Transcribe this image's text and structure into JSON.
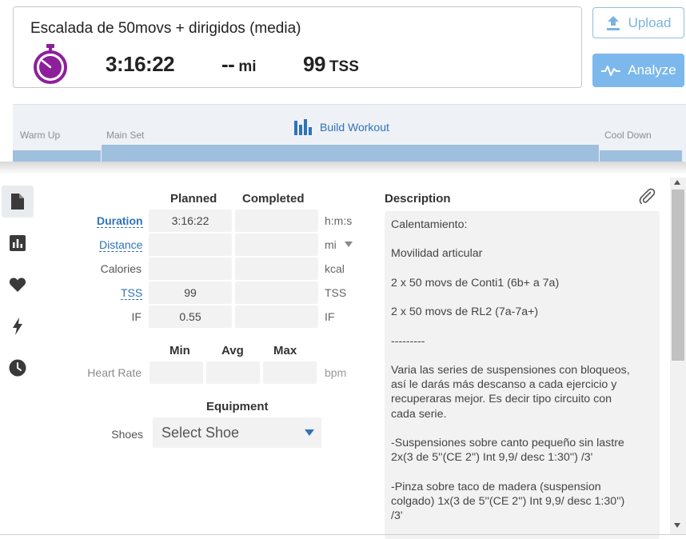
{
  "header": {
    "title": "Escalada de 50movs + dirigidos (media)",
    "duration": "3:16:22",
    "distance_value": "--",
    "distance_unit": "mi",
    "tss_value": "99",
    "tss_unit": "TSS",
    "accent_color": "#8e1f9a"
  },
  "actions": {
    "upload_label": "Upload",
    "analyze_label": "Analyze"
  },
  "builder": {
    "warm_up": "Warm Up",
    "main_set": "Main Set",
    "cool_down": "Cool Down",
    "build_link": "Build Workout"
  },
  "rail": [
    "document-icon",
    "chart-icon",
    "heart-icon",
    "bolt-icon",
    "clock-icon"
  ],
  "form": {
    "planned_header": "Planned",
    "completed_header": "Completed",
    "rows": [
      {
        "label": "Duration",
        "planned": "3:16:22",
        "completed": "",
        "unit": "h:m:s"
      },
      {
        "label": "Distance",
        "planned": "",
        "completed": "",
        "unit": "mi"
      },
      {
        "label": "Calories",
        "planned": "",
        "completed": "",
        "unit": "kcal"
      },
      {
        "label": "TSS",
        "planned": "99",
        "completed": "",
        "unit": "TSS"
      },
      {
        "label": "IF",
        "planned": "0.55",
        "completed": "",
        "unit": "IF"
      }
    ],
    "min_header": "Min",
    "avg_header": "Avg",
    "max_header": "Max",
    "heart_rate_label": "Heart Rate",
    "heart_rate_unit": "bpm",
    "equipment_header": "Equipment",
    "shoes_label": "Shoes",
    "shoes_value": "Select Shoe"
  },
  "description": {
    "title": "Description",
    "lines": [
      "Calentamiento:",
      "",
      "Movilidad articular",
      "",
      "2 x 50 movs de Conti1 (6b+ a 7a)",
      "",
      "2 x 50 movs de RL2 (7a-7a+)",
      "",
      "---------",
      "",
      "Varia las series de suspensiones con bloqueos,",
      "así le darás más descanso a cada ejercicio y",
      "recuperaras mejor. Es decir tipo circuito con",
      "cada serie.",
      "",
      "-Suspensiones sobre canto pequeño sin lastre",
      "2x(3 de 5''(CE 2'') Int 9,9/ desc 1:30'') /3'",
      "",
      "-Pinza sobre taco de madera (suspension",
      "colgado) 1x(3 de 5''(CE 2'') Int 9,9/ desc 1:30'')",
      "/3'"
    ]
  }
}
